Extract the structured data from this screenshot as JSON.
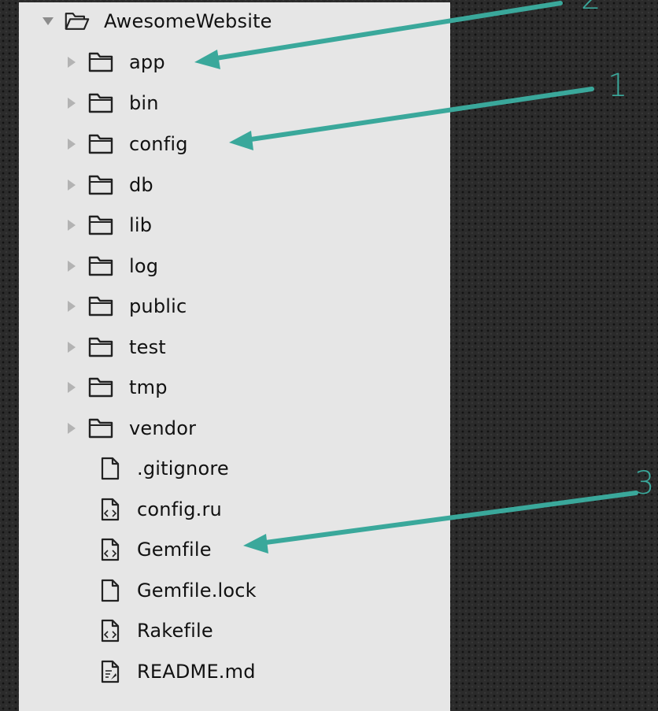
{
  "tree": {
    "root": {
      "label": "AwesomeWebsite"
    },
    "folders": [
      {
        "label": "app"
      },
      {
        "label": "bin"
      },
      {
        "label": "config"
      },
      {
        "label": "db"
      },
      {
        "label": "lib"
      },
      {
        "label": "log"
      },
      {
        "label": "public"
      },
      {
        "label": "test"
      },
      {
        "label": "tmp"
      },
      {
        "label": "vendor"
      }
    ],
    "files": [
      {
        "label": ".gitignore",
        "icon": "file-icon"
      },
      {
        "label": "config.ru",
        "icon": "code-file-icon"
      },
      {
        "label": "Gemfile",
        "icon": "code-file-icon"
      },
      {
        "label": "Gemfile.lock",
        "icon": "file-icon"
      },
      {
        "label": "Rakefile",
        "icon": "code-file-icon"
      },
      {
        "label": "README.md",
        "icon": "markdown-file-icon"
      }
    ]
  },
  "callouts": [
    {
      "label": "2"
    },
    {
      "label": "1"
    },
    {
      "label": "3"
    }
  ],
  "colors": {
    "accent": "#3aa89b",
    "panel": "#e6e6e6",
    "background": "#2b2b2b",
    "text": "#111111"
  }
}
